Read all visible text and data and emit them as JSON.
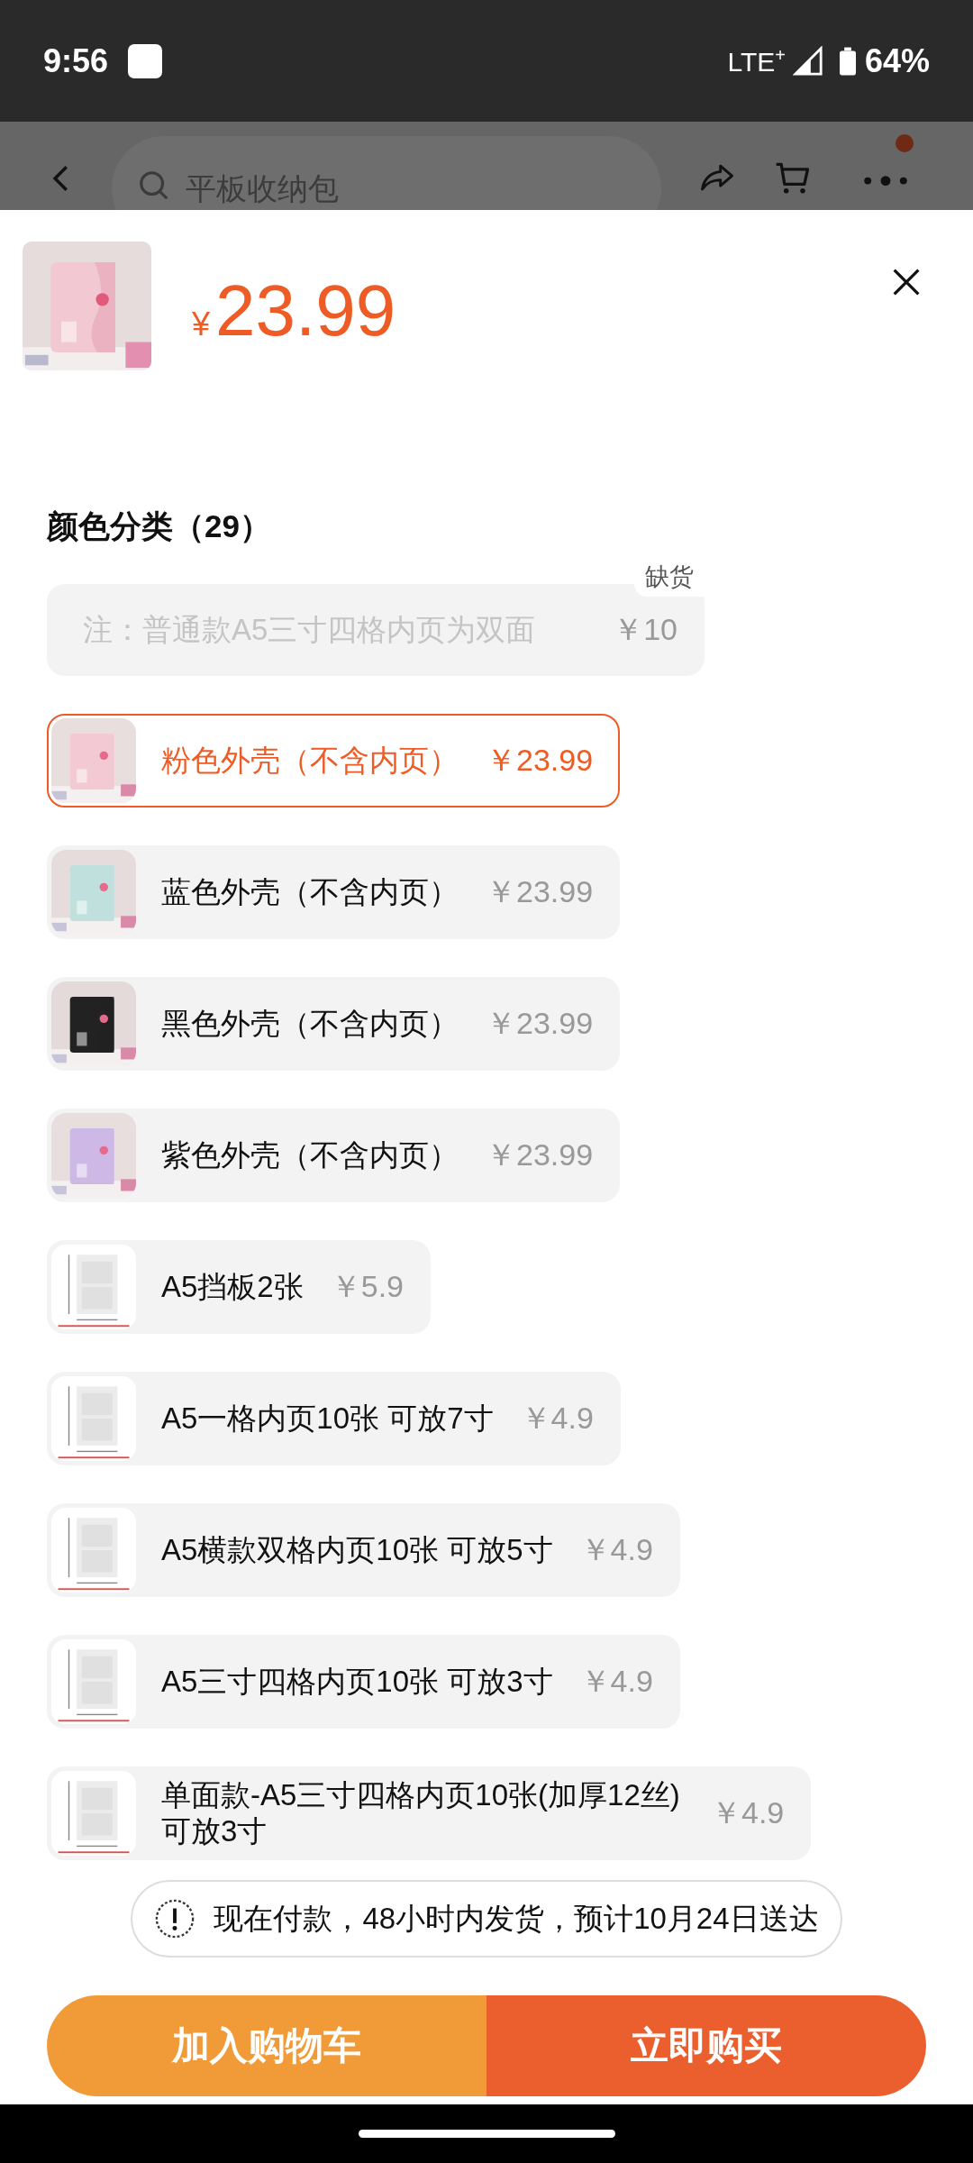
{
  "status_bar": {
    "time": "9:56",
    "network": "LTE$^{+}$",
    "battery": "64%"
  },
  "header": {
    "search": {
      "placeholder": "平板收纳包"
    },
    "notification_dot": true
  },
  "product": {
    "currency": "¥",
    "price": "23.99"
  },
  "section": {
    "title": "颜色分类（29）",
    "options": [
      {
        "label": "注：普通款A5三寸四格内页为双面",
        "price": "￥10",
        "badge": "缺货",
        "selected": false,
        "disabled": true
      },
      {
        "label": "粉色外壳（不含内页）",
        "price": "￥23.99",
        "selected": true,
        "disabled": false
      },
      {
        "label": "蓝色外壳（不含内页）",
        "price": "￥23.99",
        "selected": false,
        "disabled": false
      },
      {
        "label": "黑色外壳（不含内页）",
        "price": "￥23.99",
        "selected": false,
        "disabled": false
      },
      {
        "label": "紫色外壳（不含内页）",
        "price": "￥23.99",
        "selected": false,
        "disabled": false
      },
      {
        "label": "A5挡板2张",
        "price": "￥5.9",
        "selected": false,
        "disabled": false
      },
      {
        "label": "A5一格内页10张 可放7寸",
        "price": "￥4.9",
        "selected": false,
        "disabled": false
      },
      {
        "label": "A5横款双格内页10张 可放5寸",
        "price": "￥4.9",
        "selected": false,
        "disabled": false
      },
      {
        "label": "A5三寸四格内页10张 可放3寸",
        "price": "￥4.9",
        "selected": false,
        "disabled": false
      },
      {
        "label": "单面款-A5三寸四格内页10张(加厚12丝) 可放3寸",
        "price": "￥4.9",
        "selected": false,
        "disabled": false
      }
    ]
  },
  "notice": "现在付款，48小时内发货，预计10月24日送达",
  "buttons": [
    {
      "label": "加入购物车",
      "kind": "cart"
    },
    {
      "label": "立即购买",
      "kind": "buy"
    }
  ]
}
